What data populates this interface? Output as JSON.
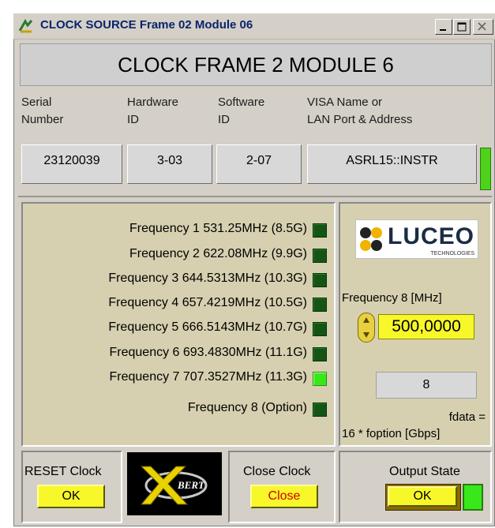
{
  "window": {
    "title": "CLOCK SOURCE Frame 02 Module 06"
  },
  "banner": {
    "text": "CLOCK FRAME 2 MODULE 6"
  },
  "headers": {
    "serial": [
      "Serial",
      "Number"
    ],
    "hardware": [
      "Hardware",
      "ID"
    ],
    "software": [
      "Software",
      "ID"
    ],
    "visa": [
      "VISA Name or",
      "LAN Port & Address"
    ]
  },
  "values": {
    "serial": "23120039",
    "hardware": "3-03",
    "software": "2-07",
    "visa": "ASRL15::INSTR"
  },
  "frequencies": [
    {
      "label": "Frequency 1  531.25MHz (8.5G)",
      "on": false
    },
    {
      "label": "Frequency 2  622.08MHz (9.9G)",
      "on": false
    },
    {
      "label": "Frequency 3  644.5313MHz (10.3G)",
      "on": false
    },
    {
      "label": "Frequency 4  657.4219MHz (10.5G)",
      "on": false
    },
    {
      "label": "Frequency 5  666.5143MHz (10.7G)",
      "on": false
    },
    {
      "label": "Frequency 6  693.4830MHz (11.1G)",
      "on": false
    },
    {
      "label": "Frequency 7  707.3527MHz (11.3G)",
      "on": true
    },
    {
      "label": "Frequency 8  (Option)",
      "on": false
    }
  ],
  "logo": {
    "brand": "LUCEO",
    "sub": "TECHNOLOGIES"
  },
  "freq8": {
    "label": "Frequency 8 [MHz]",
    "value": "500,0000"
  },
  "ratio": {
    "value": "8",
    "formula_line1": "fdata =",
    "formula_line2": "16 * foption [Gbps]"
  },
  "controls": {
    "reset_label": "RESET Clock",
    "reset_button": "OK",
    "xbert_text": "BERT",
    "close_label": "Close Clock",
    "close_button": "Close",
    "output_label": "Output State",
    "output_button": "OK"
  },
  "colors": {
    "led_on": "#38e81a",
    "led_off": "#145414",
    "button_yellow": "#f7f72a",
    "close_text": "#d40000",
    "title_text": "#0a246a"
  }
}
